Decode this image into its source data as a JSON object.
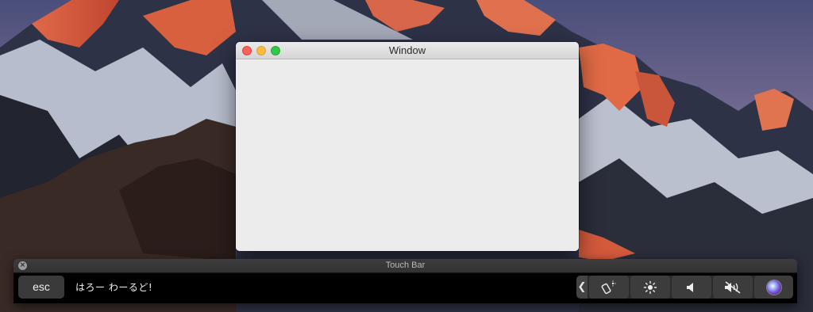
{
  "window": {
    "title": "Window"
  },
  "touch_bar": {
    "title": "Touch Bar",
    "esc_label": "esc",
    "text": "はろー わーるど!",
    "control_strip": {
      "collapse_glyph": "❮",
      "items": [
        "brightness-shortcut-icon",
        "brightness-icon",
        "volume-icon",
        "mute-icon",
        "siri-icon"
      ]
    }
  },
  "colors": {
    "close": "#fc605c",
    "minimize": "#fdbc40",
    "zoom": "#34c84a",
    "window_bg": "#ececec",
    "touch_bar_bg": "#000000"
  }
}
